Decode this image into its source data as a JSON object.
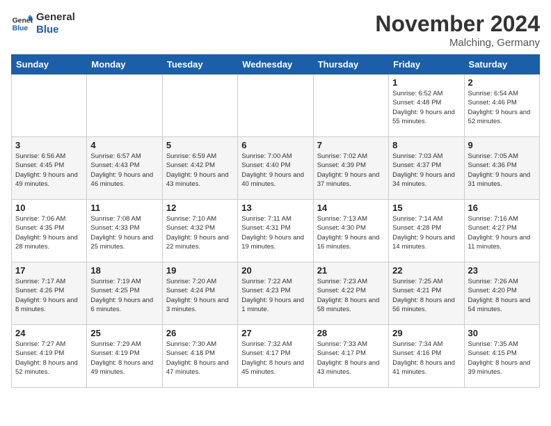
{
  "logo": {
    "line1": "General",
    "line2": "Blue"
  },
  "title": "November 2024",
  "location": "Malching, Germany",
  "weekdays": [
    "Sunday",
    "Monday",
    "Tuesday",
    "Wednesday",
    "Thursday",
    "Friday",
    "Saturday"
  ],
  "weeks": [
    [
      {
        "day": "",
        "info": ""
      },
      {
        "day": "",
        "info": ""
      },
      {
        "day": "",
        "info": ""
      },
      {
        "day": "",
        "info": ""
      },
      {
        "day": "",
        "info": ""
      },
      {
        "day": "1",
        "info": "Sunrise: 6:52 AM\nSunset: 4:48 PM\nDaylight: 9 hours and 55 minutes."
      },
      {
        "day": "2",
        "info": "Sunrise: 6:54 AM\nSunset: 4:46 PM\nDaylight: 9 hours and 52 minutes."
      }
    ],
    [
      {
        "day": "3",
        "info": "Sunrise: 6:56 AM\nSunset: 4:45 PM\nDaylight: 9 hours and 49 minutes."
      },
      {
        "day": "4",
        "info": "Sunrise: 6:57 AM\nSunset: 4:43 PM\nDaylight: 9 hours and 46 minutes."
      },
      {
        "day": "5",
        "info": "Sunrise: 6:59 AM\nSunset: 4:42 PM\nDaylight: 9 hours and 43 minutes."
      },
      {
        "day": "6",
        "info": "Sunrise: 7:00 AM\nSunset: 4:40 PM\nDaylight: 9 hours and 40 minutes."
      },
      {
        "day": "7",
        "info": "Sunrise: 7:02 AM\nSunset: 4:39 PM\nDaylight: 9 hours and 37 minutes."
      },
      {
        "day": "8",
        "info": "Sunrise: 7:03 AM\nSunset: 4:37 PM\nDaylight: 9 hours and 34 minutes."
      },
      {
        "day": "9",
        "info": "Sunrise: 7:05 AM\nSunset: 4:36 PM\nDaylight: 9 hours and 31 minutes."
      }
    ],
    [
      {
        "day": "10",
        "info": "Sunrise: 7:06 AM\nSunset: 4:35 PM\nDaylight: 9 hours and 28 minutes."
      },
      {
        "day": "11",
        "info": "Sunrise: 7:08 AM\nSunset: 4:33 PM\nDaylight: 9 hours and 25 minutes."
      },
      {
        "day": "12",
        "info": "Sunrise: 7:10 AM\nSunset: 4:32 PM\nDaylight: 9 hours and 22 minutes."
      },
      {
        "day": "13",
        "info": "Sunrise: 7:11 AM\nSunset: 4:31 PM\nDaylight: 9 hours and 19 minutes."
      },
      {
        "day": "14",
        "info": "Sunrise: 7:13 AM\nSunset: 4:30 PM\nDaylight: 9 hours and 16 minutes."
      },
      {
        "day": "15",
        "info": "Sunrise: 7:14 AM\nSunset: 4:28 PM\nDaylight: 9 hours and 14 minutes."
      },
      {
        "day": "16",
        "info": "Sunrise: 7:16 AM\nSunset: 4:27 PM\nDaylight: 9 hours and 11 minutes."
      }
    ],
    [
      {
        "day": "17",
        "info": "Sunrise: 7:17 AM\nSunset: 4:26 PM\nDaylight: 9 hours and 8 minutes."
      },
      {
        "day": "18",
        "info": "Sunrise: 7:19 AM\nSunset: 4:25 PM\nDaylight: 9 hours and 6 minutes."
      },
      {
        "day": "19",
        "info": "Sunrise: 7:20 AM\nSunset: 4:24 PM\nDaylight: 9 hours and 3 minutes."
      },
      {
        "day": "20",
        "info": "Sunrise: 7:22 AM\nSunset: 4:23 PM\nDaylight: 9 hours and 1 minute."
      },
      {
        "day": "21",
        "info": "Sunrise: 7:23 AM\nSunset: 4:22 PM\nDaylight: 8 hours and 58 minutes."
      },
      {
        "day": "22",
        "info": "Sunrise: 7:25 AM\nSunset: 4:21 PM\nDaylight: 8 hours and 56 minutes."
      },
      {
        "day": "23",
        "info": "Sunrise: 7:26 AM\nSunset: 4:20 PM\nDaylight: 8 hours and 54 minutes."
      }
    ],
    [
      {
        "day": "24",
        "info": "Sunrise: 7:27 AM\nSunset: 4:19 PM\nDaylight: 8 hours and 52 minutes."
      },
      {
        "day": "25",
        "info": "Sunrise: 7:29 AM\nSunset: 4:19 PM\nDaylight: 8 hours and 49 minutes."
      },
      {
        "day": "26",
        "info": "Sunrise: 7:30 AM\nSunset: 4:18 PM\nDaylight: 8 hours and 47 minutes."
      },
      {
        "day": "27",
        "info": "Sunrise: 7:32 AM\nSunset: 4:17 PM\nDaylight: 8 hours and 45 minutes."
      },
      {
        "day": "28",
        "info": "Sunrise: 7:33 AM\nSunset: 4:17 PM\nDaylight: 8 hours and 43 minutes."
      },
      {
        "day": "29",
        "info": "Sunrise: 7:34 AM\nSunset: 4:16 PM\nDaylight: 8 hours and 41 minutes."
      },
      {
        "day": "30",
        "info": "Sunrise: 7:35 AM\nSunset: 4:15 PM\nDaylight: 8 hours and 39 minutes."
      }
    ]
  ]
}
